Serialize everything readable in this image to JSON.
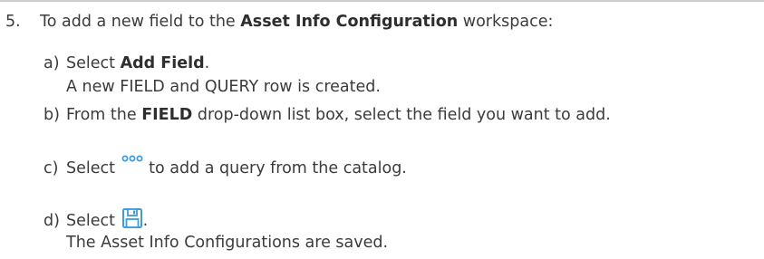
{
  "step": {
    "number": "5.",
    "text_before": "To add a new field to the ",
    "bold_text": "Asset Info Configuration",
    "text_after": " workspace:"
  },
  "substeps": {
    "a": {
      "letter": "a)",
      "text_before": "Select ",
      "bold_text": "Add Field",
      "text_after": ".",
      "result": "A new FIELD and QUERY row is created."
    },
    "b": {
      "letter": "b)",
      "text_before": "From the ",
      "bold_text": "FIELD",
      "text_after": " drop-down list box, select the field you want to add."
    },
    "c": {
      "letter": "c)",
      "text_before": "Select ",
      "icon": "more-options-dots-icon",
      "text_after": " to add a query from the catalog."
    },
    "d": {
      "letter": "d)",
      "text_before": "Select ",
      "icon": "save-floppy-icon",
      "text_after": ".",
      "result": "The Asset Info Configurations are saved."
    }
  },
  "colors": {
    "icon_blue": "#3d9ce0",
    "text": "#3b3b3b",
    "rule": "#cfcfcf"
  }
}
